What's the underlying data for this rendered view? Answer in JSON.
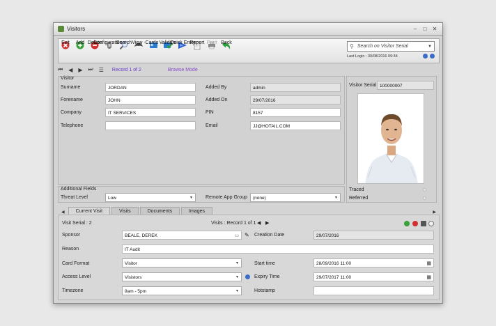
{
  "window": {
    "title": "Visitors"
  },
  "toolbar": {
    "buttons": [
      {
        "label": "Exit",
        "icon": "exit-icon",
        "color": "#d03030"
      },
      {
        "label": "Add",
        "icon": "add-icon",
        "color": "#3aa03a"
      },
      {
        "label": "Delete",
        "icon": "delete-icon",
        "color": "#d03030"
      },
      {
        "label": "Configuration ·",
        "icon": "configuration-icon",
        "color": "#6a6a6a"
      },
      {
        "label": "Search",
        "icon": "search-icon",
        "color": "#5a7ab0"
      },
      {
        "label": "View ·",
        "icon": "view-icon",
        "color": "#444444"
      },
      {
        "label": "Cards ·",
        "icon": "cards-icon",
        "color": "#2a7ad0"
      },
      {
        "label": "Validate",
        "icon": "validate-icon",
        "color": "#2a9a4a"
      },
      {
        "label": "Quick Entry",
        "icon": "quick-entry-icon",
        "color": "#2a5ad0"
      },
      {
        "label": "Report",
        "icon": "report-icon",
        "color": "#888888"
      },
      {
        "label": "Print",
        "icon": "print-icon",
        "color": "#777777"
      },
      {
        "label": "Back",
        "icon": "back-icon",
        "color": "#2aa03a"
      }
    ],
    "search_placeholder": "Search on Visitor Serial",
    "last_login": "Last Login : 30/08/2016 09:34"
  },
  "nav": {
    "record": "Record 1 of 2",
    "mode": "Browse Mode"
  },
  "visitor": {
    "section_label": "Visitor",
    "surname_label": "Surname",
    "surname": "JORDAN",
    "forename_label": "Forename",
    "forename": "JOHN",
    "company_label": "Company",
    "company": "IT SERVICES",
    "telephone_label": "Telephone",
    "telephone": "",
    "added_by_label": "Added By",
    "added_by": "admin",
    "added_on_label": "Added On",
    "added_on": "29/07/2016",
    "pin_label": "PIN",
    "pin": "8157",
    "email_label": "Email",
    "email": "JJ@HOTAIL.COM",
    "serial_label": "Visitor Serial",
    "serial": "100000007",
    "traced_label": "Traced",
    "referred_label": "Referred"
  },
  "additional": {
    "section_label": "Additional Fields",
    "threat_label": "Threat Level",
    "threat": "Low",
    "remote_label": "Remote App Group",
    "remote": "(none)"
  },
  "tabs": [
    "Current Visit",
    "Visits",
    "Documents",
    "Images"
  ],
  "visit": {
    "serial_text": "Visit Serial :  2",
    "visits_text": "Visits : Record 1 of 1",
    "sponsor_label": "Sponsor",
    "sponsor": "BEALE, DEREK",
    "creation_label": "Creation Date",
    "creation": "29/07/2016",
    "reason_label": "Reason",
    "reason": "IT Audit",
    "card_format_label": "Card Format",
    "card_format": "Visitor",
    "start_label": "Start time",
    "start": "28/09/2016 11:00",
    "access_label": "Access Level",
    "access": "Visistors",
    "expiry_label": "Expiry Time",
    "expiry": "29/07/2017 11:00",
    "timezone_label": "Timezone",
    "timezone": "9am - 5pm",
    "hotstamp_label": "Hotstamp",
    "hotstamp": ""
  }
}
